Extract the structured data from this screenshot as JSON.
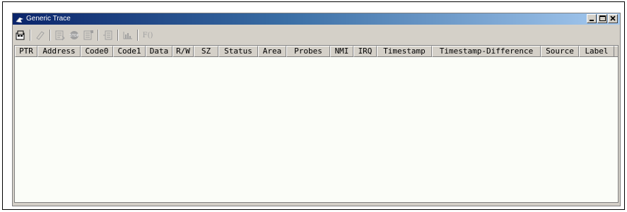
{
  "window": {
    "title": "Generic Trace",
    "buttons": [
      "minimize",
      "maximize",
      "close"
    ]
  },
  "toolbar": {
    "items": [
      "properties-icon",
      "eraser-icon",
      "list-icon",
      "stop-icon",
      "config-icon",
      "back-icon",
      "chart-icon",
      "function-icon"
    ],
    "function_label": "F()"
  },
  "table": {
    "columns": [
      "PTR",
      "Address",
      "Code0",
      "Code1",
      "Data",
      "R/W",
      "SZ",
      "Status",
      "Area",
      "Probes",
      "NMI",
      "IRQ",
      "Timestamp",
      "Timestamp-Difference",
      "Source",
      "Label"
    ],
    "rows": []
  },
  "colors": {
    "title_gradient_start": "#0a246a",
    "title_gradient_end": "#a6caf0",
    "content_background": "#fbfdf8"
  }
}
